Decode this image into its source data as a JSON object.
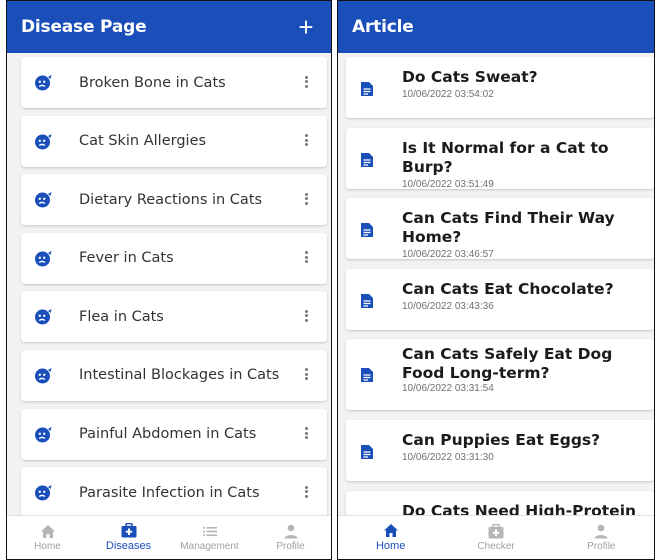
{
  "disease_screen": {
    "title": "Disease Page",
    "add_symbol": "+",
    "items": [
      {
        "label": "Broken Bone in Cats"
      },
      {
        "label": "Cat Skin Allergies"
      },
      {
        "label": "Dietary Reactions in Cats"
      },
      {
        "label": "Fever in Cats"
      },
      {
        "label": "Flea in Cats"
      },
      {
        "label": "Intestinal Blockages in Cats"
      },
      {
        "label": "Painful Abdomen in Cats"
      },
      {
        "label": "Parasite Infection in Cats"
      }
    ],
    "nav": [
      {
        "label": "Home",
        "icon": "home-icon"
      },
      {
        "label": "Diseases",
        "icon": "medical-bag-icon"
      },
      {
        "label": "Management",
        "icon": "list-icon"
      },
      {
        "label": "Profile",
        "icon": "person-icon"
      }
    ],
    "active_nav": "Diseases"
  },
  "article_screen": {
    "title": "Article",
    "items": [
      {
        "title": "Do Cats Sweat?",
        "date": "10/06/2022 03:54:02"
      },
      {
        "title": "Is It Normal for a Cat to Burp?",
        "date": "10/06/2022 03:51:49"
      },
      {
        "title": "Can Cats Find Their Way Home?",
        "date": "10/06/2022 03:46:57"
      },
      {
        "title": "Can Cats Eat Chocolate?",
        "date": "10/06/2022 03:43:36"
      },
      {
        "title": "Can Cats Safely Eat Dog Food Long-term?",
        "date": "10/06/2022 03:31:54"
      },
      {
        "title": "Can Puppies Eat Eggs?",
        "date": "10/06/2022 03:31:30"
      },
      {
        "title": "Do Cats Need High-Protein Cat Food?",
        "date": ""
      }
    ],
    "nav": [
      {
        "label": "Home",
        "icon": "home-icon"
      },
      {
        "label": "Checker",
        "icon": "medical-bag-icon"
      },
      {
        "label": "Profile",
        "icon": "person-icon"
      }
    ],
    "active_nav": "Home"
  },
  "colors": {
    "primary": "#1a4fba",
    "background": "#f2f2f4",
    "inactive": "#a0a0a0"
  }
}
